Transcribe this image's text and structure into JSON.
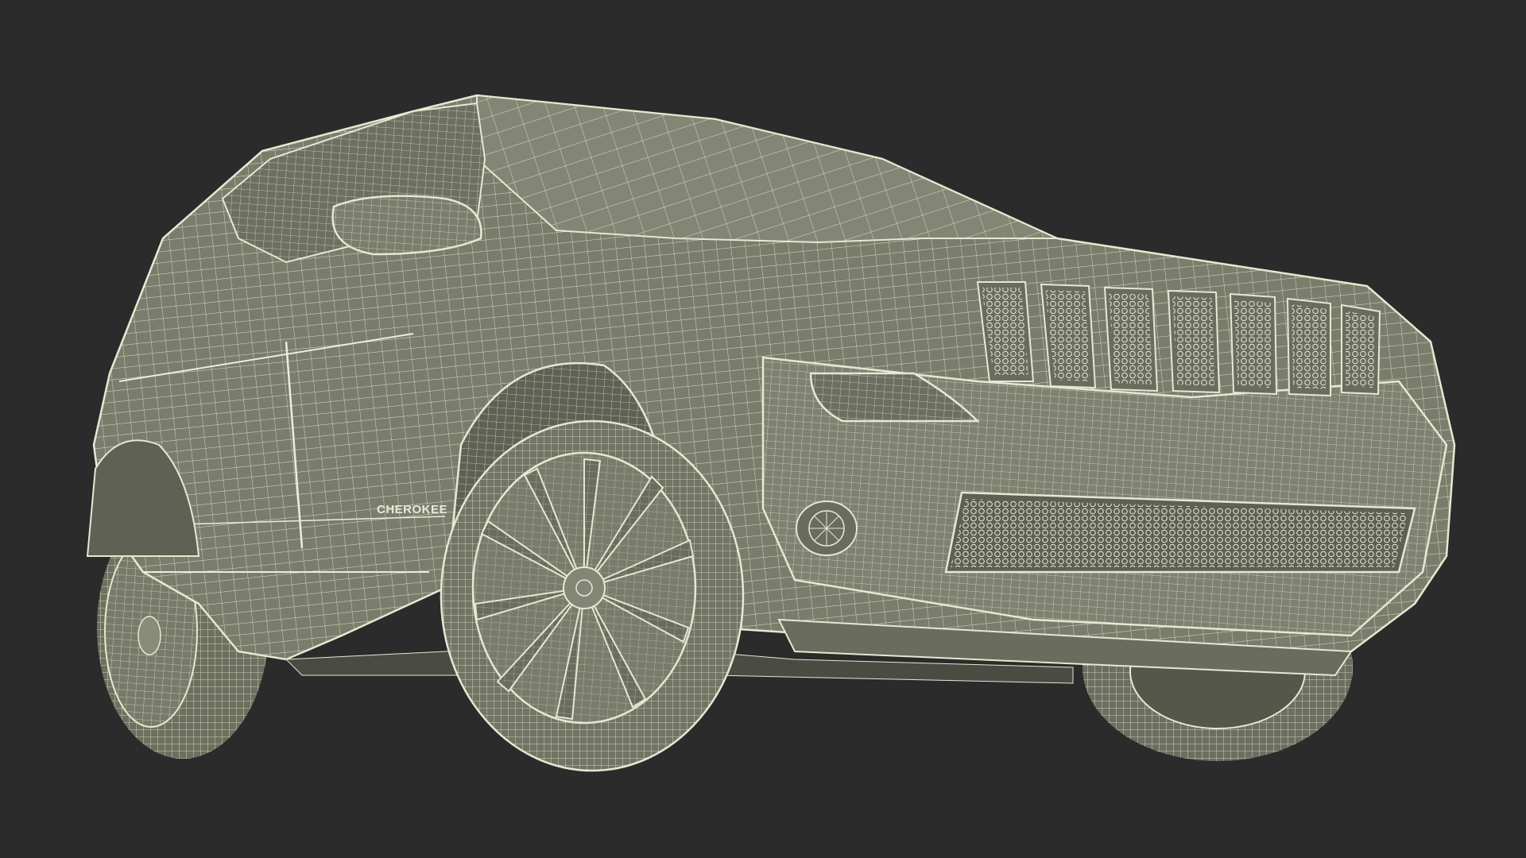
{
  "scene": {
    "background_color": "#2b2b2b",
    "body_color": "#7b7d6c",
    "body_shadow_color": "#5f6154",
    "wire_color": "#e6e8d2"
  },
  "badge": {
    "text": "CHEROKEE"
  }
}
